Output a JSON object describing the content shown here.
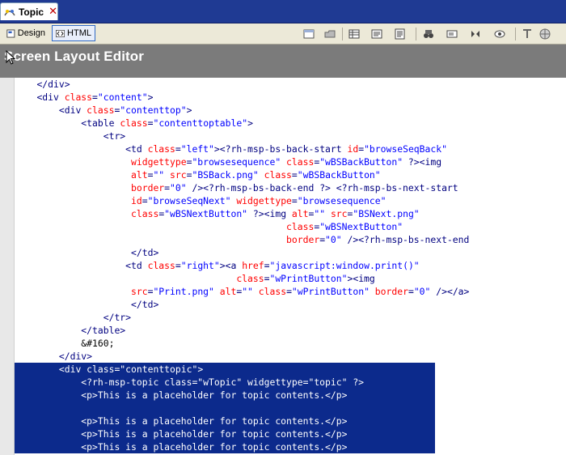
{
  "tab": {
    "label": "Topic",
    "close_glyph": "✕",
    "icon": "topic-icon"
  },
  "toolbar": {
    "design_label": "Design",
    "html_label": "HTML",
    "icons": [
      "frame-icon",
      "folder-icon",
      "table-icon",
      "list-icon",
      "paragraph-icon",
      "binoculars-icon",
      "select-icon",
      "split-icon",
      "eye-icon",
      "text-icon",
      "globe-icon"
    ]
  },
  "title": "Screen Layout Editor",
  "colors": {
    "selection": "#0c2a8c",
    "tag": "#000080",
    "attribute": "#ff0000",
    "value": "#0000ff",
    "title_band": "#7b7b7b"
  },
  "code_lines": [
    {
      "indent": "    ",
      "sel": false,
      "tokens": [
        {
          "c": "t",
          "s": "</div>"
        }
      ]
    },
    {
      "indent": "    ",
      "sel": false,
      "tokens": [
        {
          "c": "t",
          "s": "<div "
        },
        {
          "c": "a",
          "s": "class"
        },
        {
          "c": "t",
          "s": "="
        },
        {
          "c": "v",
          "s": "\"content\""
        },
        {
          "c": "t",
          "s": ">"
        }
      ]
    },
    {
      "indent": "        ",
      "sel": false,
      "tokens": [
        {
          "c": "t",
          "s": "<div "
        },
        {
          "c": "a",
          "s": "class"
        },
        {
          "c": "t",
          "s": "="
        },
        {
          "c": "v",
          "s": "\"contenttop\""
        },
        {
          "c": "t",
          "s": ">"
        }
      ]
    },
    {
      "indent": "            ",
      "sel": false,
      "tokens": [
        {
          "c": "t",
          "s": "<table "
        },
        {
          "c": "a",
          "s": "class"
        },
        {
          "c": "t",
          "s": "="
        },
        {
          "c": "v",
          "s": "\"contenttoptable\""
        },
        {
          "c": "t",
          "s": ">"
        }
      ]
    },
    {
      "indent": "                ",
      "sel": false,
      "tokens": [
        {
          "c": "t",
          "s": "<tr>"
        }
      ]
    },
    {
      "indent": "                    ",
      "sel": false,
      "tokens": [
        {
          "c": "t",
          "s": "<td "
        },
        {
          "c": "a",
          "s": "class"
        },
        {
          "c": "t",
          "s": "="
        },
        {
          "c": "v",
          "s": "\"left\""
        },
        {
          "c": "t",
          "s": "><?rh-msp-bs-back-start "
        },
        {
          "c": "a",
          "s": "id"
        },
        {
          "c": "t",
          "s": "="
        },
        {
          "c": "v",
          "s": "\"browseSeqBack\""
        }
      ]
    },
    {
      "indent": "                     ",
      "sel": false,
      "tokens": [
        {
          "c": "a",
          "s": "widgettype"
        },
        {
          "c": "t",
          "s": "="
        },
        {
          "c": "v",
          "s": "\"browsesequence\" "
        },
        {
          "c": "a",
          "s": "class"
        },
        {
          "c": "t",
          "s": "="
        },
        {
          "c": "v",
          "s": "\"wBSBackButton\""
        },
        {
          "c": "t",
          "s": " ?><img"
        }
      ]
    },
    {
      "indent": "                     ",
      "sel": false,
      "tokens": [
        {
          "c": "a",
          "s": "alt"
        },
        {
          "c": "t",
          "s": "="
        },
        {
          "c": "v",
          "s": "\"\" "
        },
        {
          "c": "a",
          "s": "src"
        },
        {
          "c": "t",
          "s": "="
        },
        {
          "c": "v",
          "s": "\"BSBack.png\" "
        },
        {
          "c": "a",
          "s": "class"
        },
        {
          "c": "t",
          "s": "="
        },
        {
          "c": "v",
          "s": "\"wBSBackButton\""
        }
      ]
    },
    {
      "indent": "                     ",
      "sel": false,
      "tokens": [
        {
          "c": "a",
          "s": "border"
        },
        {
          "c": "t",
          "s": "="
        },
        {
          "c": "v",
          "s": "\"0\""
        },
        {
          "c": "t",
          "s": " /><?rh-msp-bs-back-end ?> <?rh-msp-bs-next-start"
        }
      ]
    },
    {
      "indent": "                     ",
      "sel": false,
      "tokens": [
        {
          "c": "a",
          "s": "id"
        },
        {
          "c": "t",
          "s": "="
        },
        {
          "c": "v",
          "s": "\"browseSeqNext\" "
        },
        {
          "c": "a",
          "s": "widgettype"
        },
        {
          "c": "t",
          "s": "="
        },
        {
          "c": "v",
          "s": "\"browsesequence\""
        }
      ]
    },
    {
      "indent": "                     ",
      "sel": false,
      "tokens": [
        {
          "c": "a",
          "s": "class"
        },
        {
          "c": "t",
          "s": "="
        },
        {
          "c": "v",
          "s": "\"wBSNextButton\""
        },
        {
          "c": "t",
          "s": " ?><img "
        },
        {
          "c": "a",
          "s": "alt"
        },
        {
          "c": "t",
          "s": "="
        },
        {
          "c": "v",
          "s": "\"\" "
        },
        {
          "c": "a",
          "s": "src"
        },
        {
          "c": "t",
          "s": "="
        },
        {
          "c": "v",
          "s": "\"BSNext.png\""
        }
      ]
    },
    {
      "indent": "                                                 ",
      "sel": false,
      "tokens": [
        {
          "c": "a",
          "s": "class"
        },
        {
          "c": "t",
          "s": "="
        },
        {
          "c": "v",
          "s": "\"wBSNextButton\""
        }
      ]
    },
    {
      "indent": "                                                 ",
      "sel": false,
      "tokens": [
        {
          "c": "a",
          "s": "border"
        },
        {
          "c": "t",
          "s": "="
        },
        {
          "c": "v",
          "s": "\"0\""
        },
        {
          "c": "t",
          "s": " /><?rh-msp-bs-next-end"
        }
      ]
    },
    {
      "indent": "                     ",
      "sel": false,
      "tokens": [
        {
          "c": "t",
          "s": "</td>"
        }
      ]
    },
    {
      "indent": "                    ",
      "sel": false,
      "tokens": [
        {
          "c": "t",
          "s": "<td "
        },
        {
          "c": "a",
          "s": "class"
        },
        {
          "c": "t",
          "s": "="
        },
        {
          "c": "v",
          "s": "\"right\""
        },
        {
          "c": "t",
          "s": "><a "
        },
        {
          "c": "a",
          "s": "href"
        },
        {
          "c": "t",
          "s": "="
        },
        {
          "c": "v",
          "s": "\"javascript:window.print()\""
        }
      ]
    },
    {
      "indent": "                                        ",
      "sel": false,
      "tokens": [
        {
          "c": "a",
          "s": "class"
        },
        {
          "c": "t",
          "s": "="
        },
        {
          "c": "v",
          "s": "\"wPrintButton\""
        },
        {
          "c": "t",
          "s": "><img"
        }
      ]
    },
    {
      "indent": "                     ",
      "sel": false,
      "tokens": [
        {
          "c": "a",
          "s": "src"
        },
        {
          "c": "t",
          "s": "="
        },
        {
          "c": "v",
          "s": "\"Print.png\" "
        },
        {
          "c": "a",
          "s": "alt"
        },
        {
          "c": "t",
          "s": "="
        },
        {
          "c": "v",
          "s": "\"\" "
        },
        {
          "c": "a",
          "s": "class"
        },
        {
          "c": "t",
          "s": "="
        },
        {
          "c": "v",
          "s": "\"wPrintButton\" "
        },
        {
          "c": "a",
          "s": "border"
        },
        {
          "c": "t",
          "s": "="
        },
        {
          "c": "v",
          "s": "\"0\""
        },
        {
          "c": "t",
          "s": " /></a>"
        }
      ]
    },
    {
      "indent": "                     ",
      "sel": false,
      "tokens": [
        {
          "c": "t",
          "s": "</td>"
        }
      ]
    },
    {
      "indent": "                ",
      "sel": false,
      "tokens": [
        {
          "c": "t",
          "s": "</tr>"
        }
      ]
    },
    {
      "indent": "            ",
      "sel": false,
      "tokens": [
        {
          "c": "t",
          "s": "</table>"
        }
      ]
    },
    {
      "indent": "            ",
      "sel": false,
      "tokens": [
        {
          "c": "x",
          "s": "&#160;"
        }
      ]
    },
    {
      "indent": "        ",
      "sel": false,
      "tokens": [
        {
          "c": "t",
          "s": "</div>"
        }
      ]
    },
    {
      "indent": "        ",
      "sel": true,
      "tokens": [
        {
          "c": "t",
          "s": "<div class=\"contenttopic\">"
        }
      ]
    },
    {
      "indent": "            ",
      "sel": true,
      "tokens": [
        {
          "c": "t",
          "s": "<?rh-msp-topic class=\"wTopic\" widgettype=\"topic\" ?>"
        }
      ]
    },
    {
      "indent": "            ",
      "sel": true,
      "tokens": [
        {
          "c": "t",
          "s": "<p>This is a placeholder for topic contents.</p>"
        }
      ]
    },
    {
      "indent": "            ",
      "sel": true,
      "tokens": [
        {
          "c": "t",
          "s": "  "
        }
      ]
    },
    {
      "indent": "            ",
      "sel": true,
      "tokens": [
        {
          "c": "t",
          "s": "<p>This is a placeholder for topic contents.</p>"
        }
      ]
    },
    {
      "indent": "            ",
      "sel": true,
      "tokens": [
        {
          "c": "t",
          "s": "<p>This is a placeholder for topic contents.</p>"
        }
      ]
    },
    {
      "indent": "            ",
      "sel": true,
      "tokens": [
        {
          "c": "t",
          "s": "<p>This is a placeholder for topic contents.</p>"
        }
      ]
    }
  ]
}
